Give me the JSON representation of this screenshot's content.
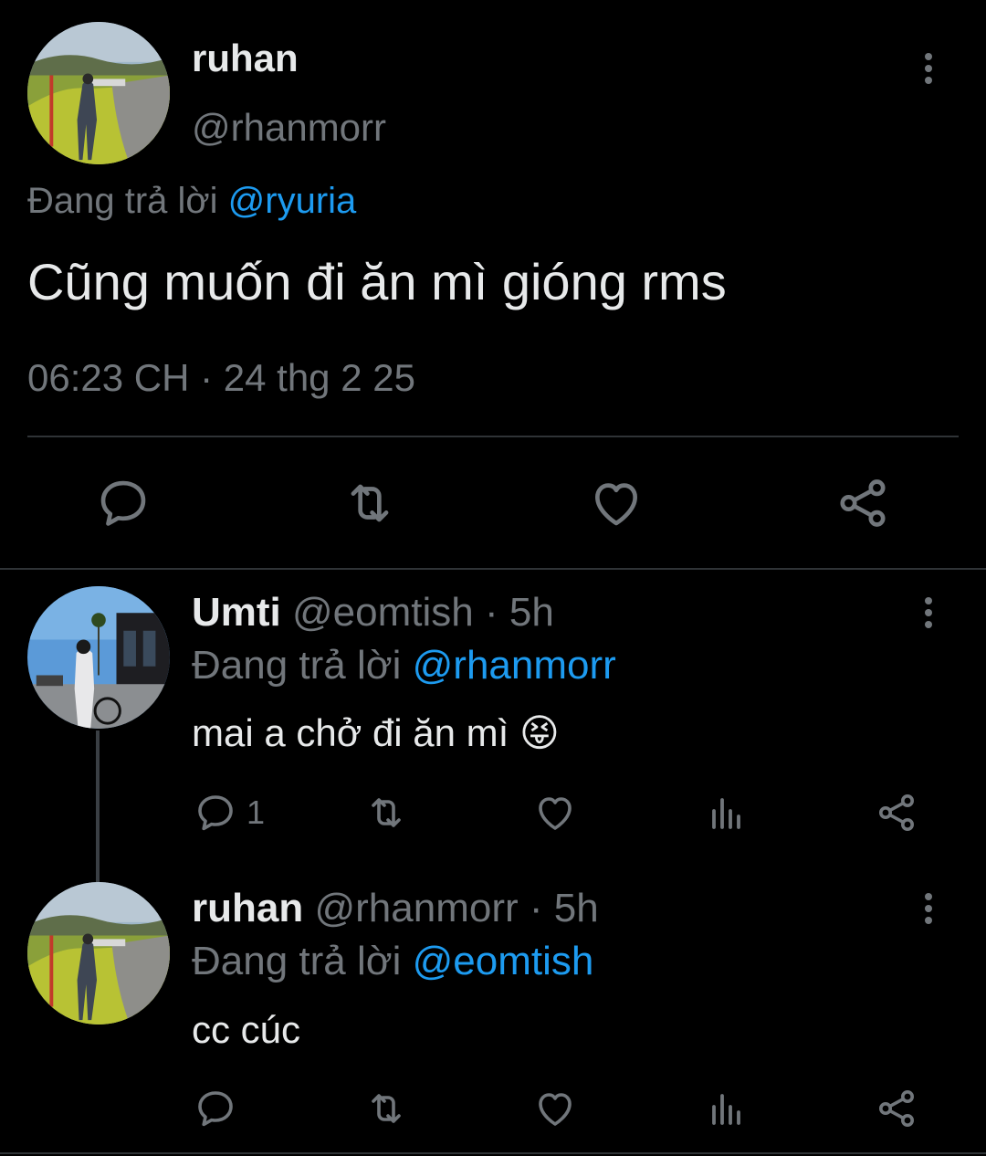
{
  "main_tweet": {
    "display_name": "ruhan",
    "handle": "@rhanmorr",
    "replying_prefix": "Đang trả lời",
    "replying_to": "@ryuria",
    "text": "Cũng muốn đi ăn mì gióng rms",
    "timestamp": "06:23 CH · 24 thg 2 25"
  },
  "replies": [
    {
      "display_name": "Umti",
      "handle": "@eomtish",
      "age": "· 5h",
      "replying_prefix": "Đang trả lời",
      "replying_to": "@rhanmorr",
      "text": "mai a chở đi ăn mì 😝",
      "reply_count": "1"
    },
    {
      "display_name": "ruhan",
      "handle": "@rhanmorr",
      "age": "· 5h",
      "replying_prefix": "Đang trả lời",
      "replying_to": "@eomtish",
      "text": "cc cúc",
      "reply_count": ""
    }
  ],
  "colors": {
    "background": "#000000",
    "text": "#e7e9ea",
    "muted": "#71767b",
    "link": "#1d9bf0",
    "divider": "#2f3336"
  },
  "icons": [
    "reply-icon",
    "retweet-icon",
    "like-icon",
    "views-icon",
    "share-icon",
    "more-icon"
  ]
}
